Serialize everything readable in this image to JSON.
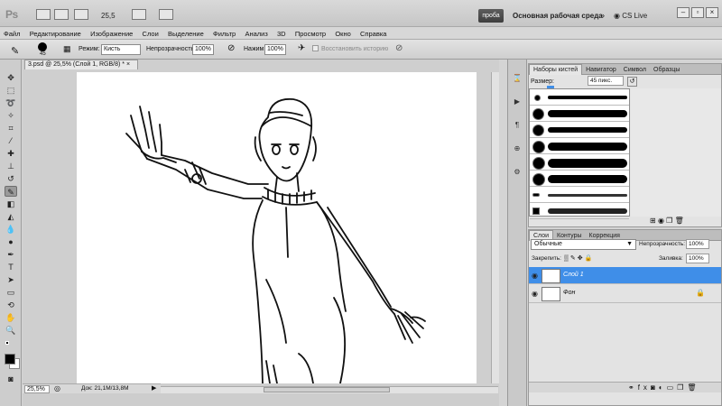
{
  "app": {
    "logo": "Ps",
    "zoom": "25,5",
    "workspace_button": "проба",
    "workspace_name": "Основная рабочая среда",
    "cs_live": "CS Live"
  },
  "menu": [
    "Файл",
    "Редактирование",
    "Изображение",
    "Слои",
    "Выделение",
    "Фильтр",
    "Анализ",
    "3D",
    "Просмотр",
    "Окно",
    "Справка"
  ],
  "options": {
    "brush_size": "45",
    "mode_label": "Режим:",
    "mode_value": "Кисть",
    "opacity_label": "Непрозрачность:",
    "opacity_value": "100%",
    "pressure_label": "Нажим:",
    "pressure_value": "100%",
    "restore_history": "Восстановить историю"
  },
  "document": {
    "tab_title": "3.psd @ 25,5% (Слой 1, RGB/8) *",
    "status_zoom": "25,5%",
    "status_doc": "Док: 21,1M/13,8M"
  },
  "brushes_panel": {
    "tabs": [
      "Наборы кистей",
      "Навигатор",
      "Символ",
      "Образцы"
    ],
    "size_label": "Размер:",
    "size_value": "45 пикс."
  },
  "layers_panel": {
    "tabs": [
      "Слои",
      "Контуры",
      "Коррекция"
    ],
    "blend_mode": "Обычные",
    "opacity_label": "Непрозрачность:",
    "opacity_value": "100%",
    "lock_label": "Закрепить:",
    "fill_label": "Заливка:",
    "fill_value": "100%",
    "layers": [
      {
        "name": "Слой 1",
        "selected": true
      },
      {
        "name": "Фон",
        "selected": false
      }
    ]
  },
  "colors": {
    "selection": "#3f8ee8"
  }
}
